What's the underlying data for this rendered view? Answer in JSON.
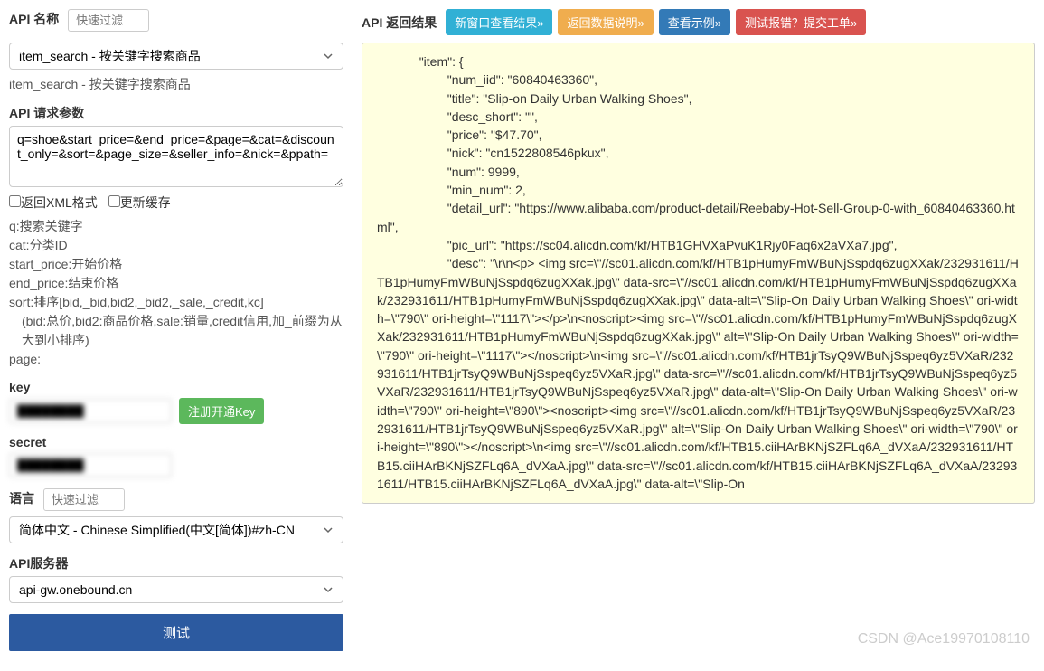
{
  "left": {
    "api_name_label": "API 名称",
    "filter_placeholder": "快速过滤",
    "api_select_value": "item_search - 按关键字搜索商品",
    "api_subtext": "item_search - 按关键字搜索商品",
    "request_params_label": "API 请求参数",
    "request_params_value": "q=shoe&start_price=&end_price=&page=&cat=&discount_only=&sort=&page_size=&seller_info=&nick=&ppath=",
    "checkbox_xml": "返回XML格式",
    "checkbox_cache": "更新缓存",
    "param_docs": [
      "q:搜索关键字",
      "cat:分类ID",
      "start_price:开始价格",
      "end_price:结束价格",
      "sort:排序[bid,_bid,bid2,_bid2,_sale,_credit,kc]",
      "  (bid:总价,bid2:商品价格,sale:销量,credit信用,加_前缀为从大到小排序)",
      "page:"
    ],
    "key_label": "key",
    "key_value": "████████",
    "register_key_btn": "注册开通Key",
    "secret_label": "secret",
    "secret_value": "████████",
    "language_label": "语言",
    "language_filter_placeholder": "快速过滤",
    "language_select_value": "简体中文 - Chinese Simplified(中文[简体])#zh-CN",
    "server_label": "API服务器",
    "server_select_value": "api-gw.onebound.cn",
    "test_btn": "测试"
  },
  "right": {
    "result_label": "API 返回结果",
    "btn_new_window": "新窗口查看结果»",
    "btn_data_desc": "返回数据说明»",
    "btn_example": "查看示例»",
    "btn_report": "测试报错？提交工单»",
    "result_text": "            \"item\": {\n                    \"num_iid\": \"60840463360\",\n                    \"title\": \"Slip-on Daily Urban Walking Shoes\",\n                    \"desc_short\": \"\",\n                    \"price\": \"$47.70\",\n                    \"nick\": \"cn1522808546pkux\",\n                    \"num\": 9999,\n                    \"min_num\": 2,\n                    \"detail_url\": \"https://www.alibaba.com/product-detail/Reebaby-Hot-Sell-Group-0-with_60840463360.html\",\n                    \"pic_url\": \"https://sc04.alicdn.com/kf/HTB1GHVXaPvuK1Rjy0Faq6x2aVXa7.jpg\",\n                    \"desc\": \"\\r\\n<p> <img src=\\\"//sc01.alicdn.com/kf/HTB1pHumyFmWBuNjSspdq6zugXXak/232931611/HTB1pHumyFmWBuNjSspdq6zugXXak.jpg\\\" data-src=\\\"//sc01.alicdn.com/kf/HTB1pHumyFmWBuNjSspdq6zugXXak/232931611/HTB1pHumyFmWBuNjSspdq6zugXXak.jpg\\\" data-alt=\\\"Slip-On Daily Urban Walking Shoes\\\" ori-width=\\\"790\\\" ori-height=\\\"1117\\\"></p>\\n<noscript><img src=\\\"//sc01.alicdn.com/kf/HTB1pHumyFmWBuNjSspdq6zugXXak/232931611/HTB1pHumyFmWBuNjSspdq6zugXXak.jpg\\\" alt=\\\"Slip-On Daily Urban Walking Shoes\\\" ori-width=\\\"790\\\" ori-height=\\\"1117\\\"></noscript>\\n<img src=\\\"//sc01.alicdn.com/kf/HTB1jrTsyQ9WBuNjSspeq6yz5VXaR/232931611/HTB1jrTsyQ9WBuNjSspeq6yz5VXaR.jpg\\\" data-src=\\\"//sc01.alicdn.com/kf/HTB1jrTsyQ9WBuNjSspeq6yz5VXaR/232931611/HTB1jrTsyQ9WBuNjSspeq6yz5VXaR.jpg\\\" data-alt=\\\"Slip-On Daily Urban Walking Shoes\\\" ori-width=\\\"790\\\" ori-height=\\\"890\\\"><noscript><img src=\\\"//sc01.alicdn.com/kf/HTB1jrTsyQ9WBuNjSspeq6yz5VXaR/232931611/HTB1jrTsyQ9WBuNjSspeq6yz5VXaR.jpg\\\" alt=\\\"Slip-On Daily Urban Walking Shoes\\\" ori-width=\\\"790\\\" ori-height=\\\"890\\\"></noscript>\\n<img src=\\\"//sc01.alicdn.com/kf/HTB15.ciiHArBKNjSZFLq6A_dVXaA/232931611/HTB15.ciiHArBKNjSZFLq6A_dVXaA.jpg\\\" data-src=\\\"//sc01.alicdn.com/kf/HTB15.ciiHArBKNjSZFLq6A_dVXaA/232931611/HTB15.ciiHArBKNjSZFLq6A_dVXaA.jpg\\\" data-alt=\\\"Slip-On"
  },
  "watermark": "CSDN @Ace19970108110"
}
